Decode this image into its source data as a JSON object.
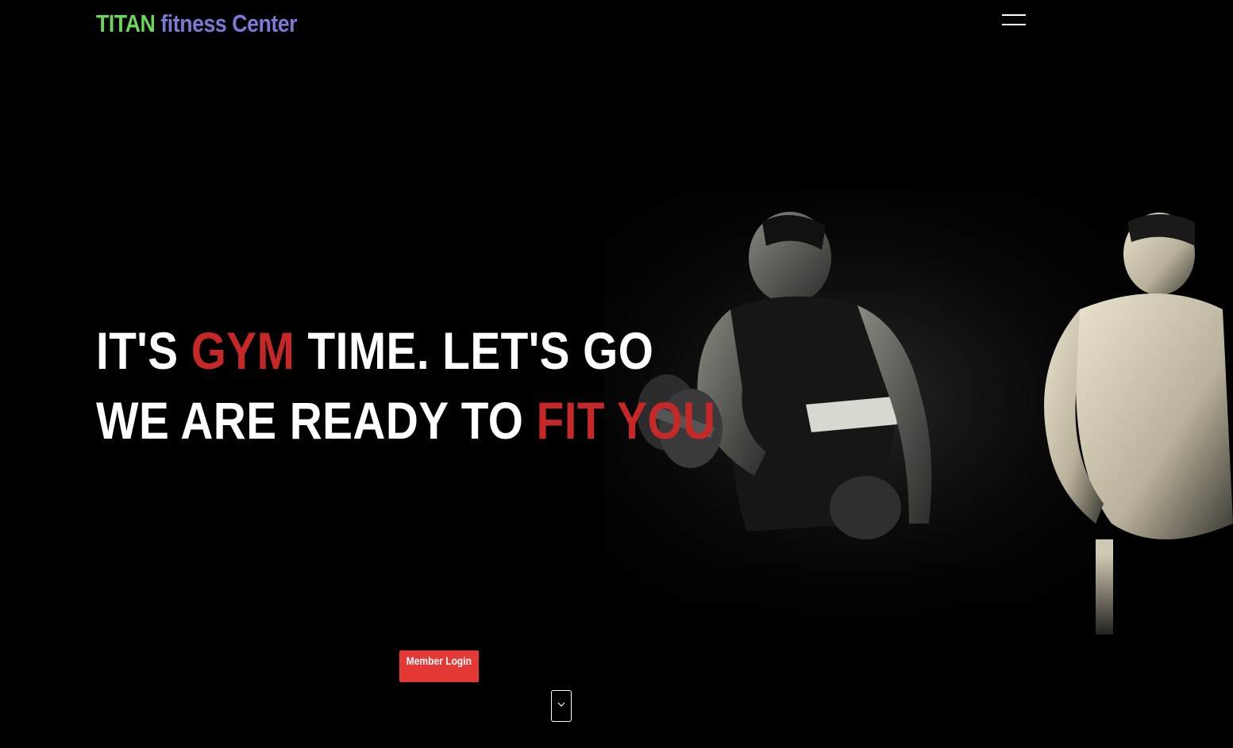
{
  "header": {
    "brand": {
      "word1": "TITAN",
      "word2": "fitness",
      "word3": "Center"
    },
    "menu_icon": "hamburger-menu-icon"
  },
  "hero": {
    "line1": {
      "part1": "IT'S ",
      "accent": "GYM",
      "part2": " TIME. LET'S GO"
    },
    "line2": {
      "part1": "WE ARE READY TO ",
      "accent": "FIT YOU"
    },
    "image_alt": "two bodybuilders, one curling a dumbbell"
  },
  "cta": {
    "member_login": "Member Login"
  },
  "scroll_icon": "chevron-down-icon",
  "colors": {
    "background": "#000000",
    "brand_green": "#6dd45c",
    "brand_purple": "#7b79d4",
    "accent_red": "#c62828",
    "button_red": "#e53935"
  }
}
